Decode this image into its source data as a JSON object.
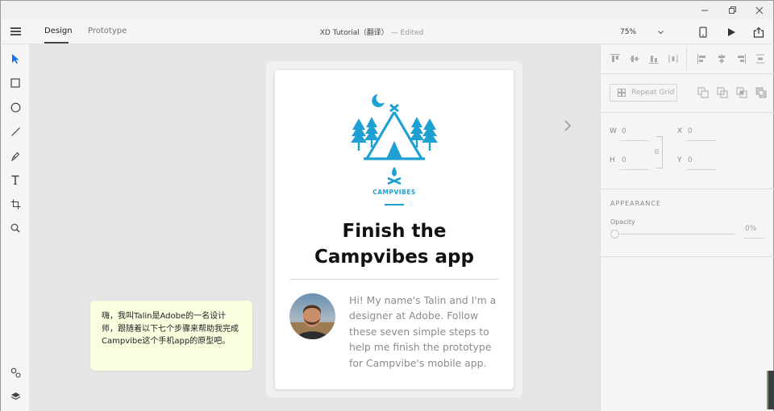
{
  "window": {
    "controls": [
      "minimize",
      "restore",
      "close"
    ]
  },
  "menubar": {
    "menu_icon": "hamburger-icon",
    "tabs": [
      {
        "label": "Design",
        "active": true
      },
      {
        "label": "Prototype",
        "active": false
      }
    ],
    "document_title": "XD Tutorial（翻译）",
    "document_status": "— Edited",
    "zoom": "75%",
    "icons": [
      "device-preview-icon",
      "play-icon",
      "share-icon"
    ]
  },
  "tools": [
    "select-icon",
    "rectangle-icon",
    "ellipse-icon",
    "line-icon",
    "pen-icon",
    "text-icon",
    "artboard-icon",
    "zoom-icon",
    "symbols-icon",
    "layers-icon"
  ],
  "artboard": {
    "brand": "CAMPVIBES",
    "headline": "Finish the Campvibes app",
    "headline_line1": "Finish the",
    "headline_line2": "Campvibes app",
    "bio": "Hi! My name's Talin and I'm a designer at Adobe. Follow these seven simple steps to help me finish the prototype for Campvibe's mobile app.",
    "accent_color": "#1ea0d2"
  },
  "note": {
    "text": "嗨，我叫Talin是Adobe的一名设计师，跟随着以下七个步骤来帮助我完成Campvibe这个手机app的原型吧。"
  },
  "inspector": {
    "repeat_grid_label": "Repeat Grid",
    "fields": {
      "w_label": "W",
      "w_value": "0",
      "h_label": "H",
      "h_value": "0",
      "x_label": "X",
      "x_value": "0",
      "y_label": "Y",
      "y_value": "0"
    },
    "appearance_title": "APPEARANCE",
    "opacity_label": "Opacity",
    "opacity_value": "0%",
    "opacity_level": 0
  }
}
